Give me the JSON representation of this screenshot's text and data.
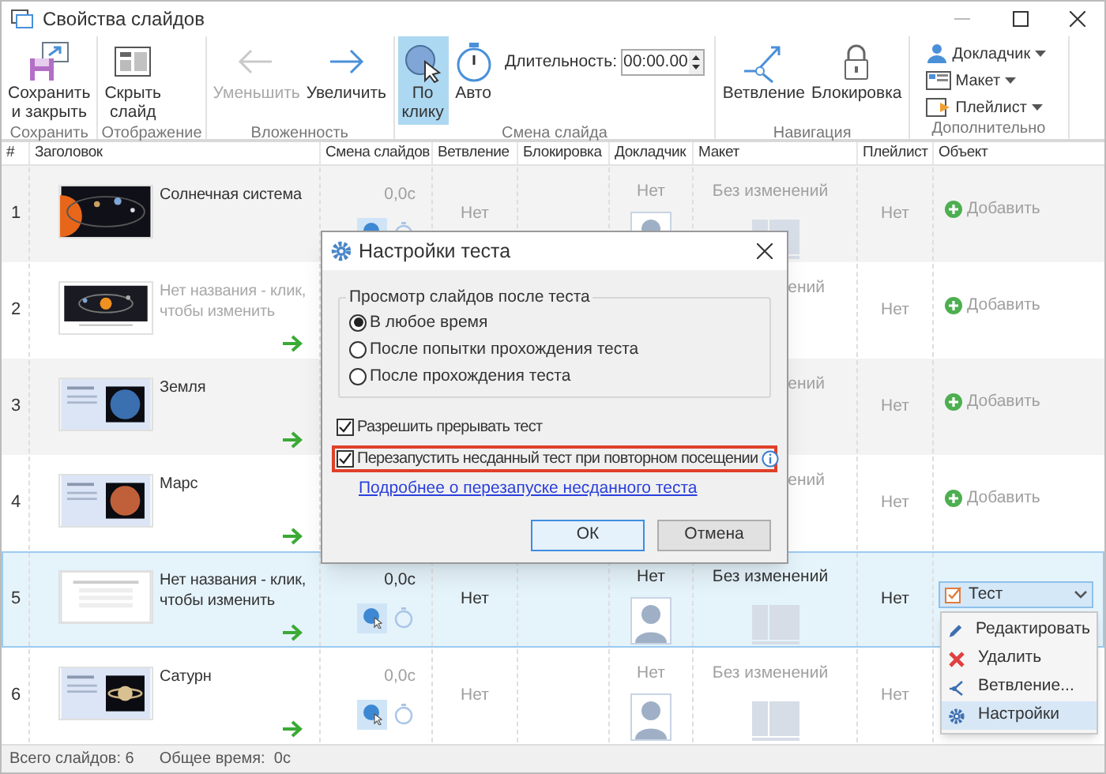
{
  "window": {
    "title": "Свойства слайдов"
  },
  "ribbon": {
    "groups": [
      {
        "label": "Сохранить",
        "buttons": [
          {
            "kind": "save",
            "label": "Сохранить\nи закрыть",
            "disabled": false,
            "selected": false
          }
        ]
      },
      {
        "label": "Отображение",
        "buttons": [
          {
            "kind": "hide",
            "label": "Скрыть\nслайд",
            "disabled": false,
            "selected": false
          }
        ]
      },
      {
        "label": "Вложенность",
        "buttons": [
          {
            "kind": "decrease",
            "label": "Уменьшить",
            "disabled": true,
            "selected": false
          },
          {
            "kind": "increase",
            "label": "Увеличить",
            "disabled": false,
            "selected": false
          }
        ]
      },
      {
        "label": "Смена слайда",
        "buttons": [
          {
            "kind": "click",
            "label": "По\nклику",
            "disabled": false,
            "selected": true
          },
          {
            "kind": "auto",
            "label": "Авто",
            "disabled": false,
            "selected": false
          }
        ],
        "duration": {
          "label": "Длительность:",
          "value": "00:00.00"
        }
      },
      {
        "label": "Навигация",
        "buttons": [
          {
            "kind": "branch",
            "label": "Ветвление",
            "disabled": false,
            "selected": false
          },
          {
            "kind": "lock",
            "label": "Блокировка",
            "disabled": false,
            "selected": false
          }
        ]
      },
      {
        "label": "Дополнительно",
        "menus": [
          {
            "kind": "presenter",
            "label": "Докладчик"
          },
          {
            "kind": "layout",
            "label": "Макет"
          },
          {
            "kind": "playlist",
            "label": "Плейлист"
          }
        ]
      }
    ]
  },
  "table": {
    "columns": [
      "#",
      "Заголовок",
      "Смена слайдов",
      "Ветвление",
      "Блокировка",
      "Докладчик",
      "Макет",
      "Плейлист",
      "Объект"
    ],
    "rows": [
      {
        "number": "1",
        "title": "Солнечная система",
        "untitled": false,
        "next_arrow": false,
        "duration": "0,0с",
        "on_click": true,
        "branching": "Нет",
        "presenter": "Нет",
        "layout": "Без изменений",
        "playlist": "Нет",
        "object": {
          "kind": "add",
          "label": "Добавить"
        },
        "selected": false
      },
      {
        "number": "2",
        "title": "Нет названия - клик, чтобы изменить",
        "untitled": true,
        "next_arrow": true,
        "layout_partial": "ений",
        "playlist": "Нет",
        "object": {
          "kind": "add",
          "label": "Добавить"
        },
        "selected": false
      },
      {
        "number": "3",
        "title": "Земля",
        "untitled": false,
        "next_arrow": true,
        "layout_partial": "ений",
        "playlist": "Нет",
        "object": {
          "kind": "add",
          "label": "Добавить"
        },
        "selected": false
      },
      {
        "number": "4",
        "title": "Марс",
        "untitled": false,
        "next_arrow": true,
        "layout_partial": "ений",
        "playlist": "Нет",
        "object": {
          "kind": "add",
          "label": "Добавить"
        },
        "selected": false
      },
      {
        "number": "5",
        "title": "Нет названия - клик, чтобы изменить",
        "untitled": true,
        "next_arrow": true,
        "duration": "0,0с",
        "on_click": true,
        "branching": "Нет",
        "presenter": "Нет",
        "layout": "Без изменений",
        "playlist": "Нет",
        "object": {
          "kind": "test",
          "label": "Тест"
        },
        "selected": true
      },
      {
        "number": "6",
        "title": "Сатурн",
        "untitled": false,
        "next_arrow": true,
        "duration": "0,0с",
        "on_click": true,
        "branching": "Нет",
        "presenter": "Нет",
        "layout": "Без изменений",
        "playlist": "Нет",
        "selected": false
      }
    ]
  },
  "object_menu": {
    "items": [
      {
        "kind": "edit",
        "label": "Редактировать",
        "selected": false
      },
      {
        "kind": "delete",
        "label": "Удалить",
        "selected": false
      },
      {
        "kind": "branch",
        "label": "Ветвление...",
        "selected": false
      },
      {
        "kind": "settings",
        "label": "Настройки",
        "selected": true
      }
    ]
  },
  "dialog": {
    "title": "Настройки теста",
    "group_label": "Просмотр слайдов после теста",
    "options": [
      {
        "label": "В любое время",
        "selected": true
      },
      {
        "label": "После попытки прохождения теста",
        "selected": false
      },
      {
        "label": "После прохождения теста",
        "selected": false
      }
    ],
    "checkboxes": [
      {
        "label": "Разрешить прерывать тест",
        "checked": true,
        "highlighted": false,
        "info": false
      },
      {
        "label": "Перезапустить несданный тест при повторном посещении",
        "checked": true,
        "highlighted": true,
        "info": true
      }
    ],
    "link": "Подробнее о перезапуске несданного теста",
    "buttons": [
      {
        "label": "ОК",
        "default": true
      },
      {
        "label": "Отмена",
        "default": false
      }
    ]
  },
  "status_bar": {
    "slides": "Всего слайдов: 6",
    "total_time": "Общее время:  0с"
  }
}
